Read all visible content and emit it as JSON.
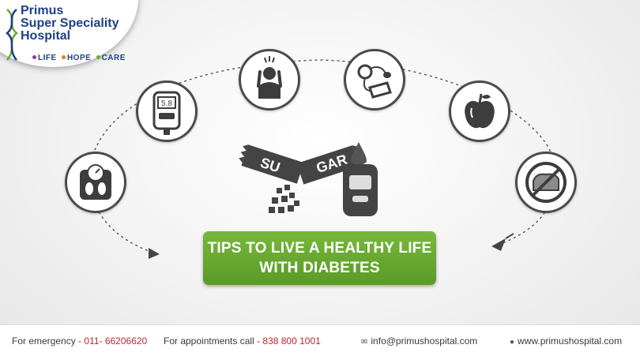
{
  "logo": {
    "line1": "Primus",
    "line2": "Super Speciality",
    "line3": "Hospital",
    "tag_life": "LIFE",
    "tag_hope": "HOPE",
    "tag_care": "CARE",
    "brand_blue": "#1f3f86",
    "dot_colors": [
      "#8e3f9a",
      "#e07b1a",
      "#6aab2e"
    ]
  },
  "icons": [
    "weighing-scale-icon",
    "glucometer-reading-icon",
    "stressed-person-icon",
    "blood-pressure-monitor-icon",
    "apple-icon",
    "no-bread-icon"
  ],
  "glucometer_reading": "5.8",
  "center_words": [
    "SU",
    "GAR"
  ],
  "banner": {
    "line1": "TIPS TO LIVE A HEALTHY LIFE",
    "line2": "WITH DIABETES",
    "color": "#6aab2e"
  },
  "footer": {
    "emergency_label": "For emergency - ",
    "emergency_number": "011- 66206620",
    "appointment_label": "For appointments call - ",
    "appointment_number": "838 800 1001",
    "email": "info@primushospital.com",
    "website": "www.primushospital.com",
    "accent": "#c0262c"
  }
}
